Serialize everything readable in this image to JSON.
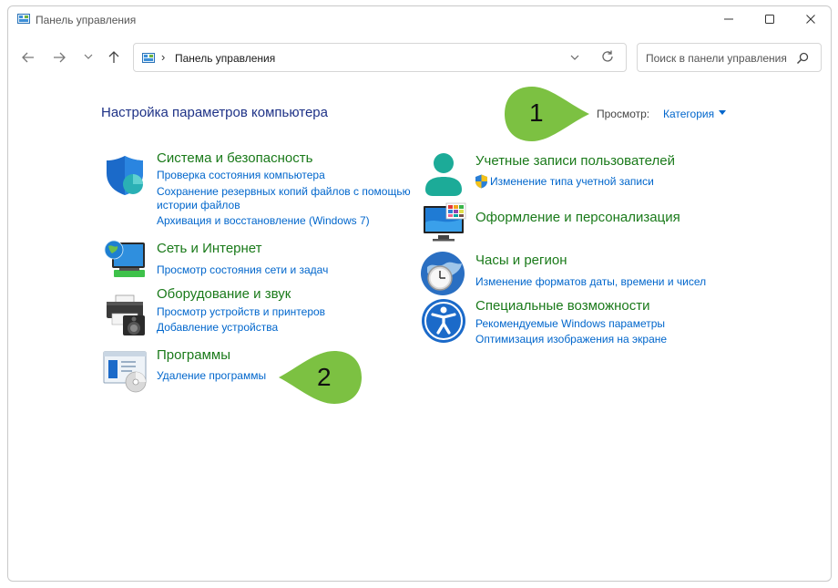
{
  "window": {
    "title": "Панель управления"
  },
  "nav": {
    "back_icon": "arrow-left-icon",
    "forward_icon": "arrow-right-icon",
    "recent_icon": "chevron-down-icon",
    "up_icon": "arrow-up-icon"
  },
  "address": {
    "path": "Панель управления"
  },
  "search": {
    "placeholder": "Поиск в панели управления"
  },
  "main": {
    "heading": "Настройка параметров компьютера",
    "view_label": "Просмотр:",
    "view_value": "Категория"
  },
  "categories": [
    {
      "title": "Система и безопасность",
      "icon": "shield-icon",
      "links": [
        "Проверка состояния компьютера",
        "Сохранение резервных копий файлов с помощью",
        "истории файлов",
        "Архивация и восстановление (Windows 7)"
      ]
    },
    {
      "title": "Сеть и Интернет",
      "icon": "network-globe-icon",
      "links": [
        "Просмотр состояния сети и задач"
      ]
    },
    {
      "title": "Оборудование и звук",
      "icon": "printer-speaker-icon",
      "links": [
        "Просмотр устройств и принтеров",
        "Добавление устройства"
      ]
    },
    {
      "title": "Программы",
      "icon": "programs-disc-icon",
      "links": [
        "Удаление программы"
      ]
    },
    {
      "title": "Учетные записи пользователей",
      "icon": "user-icon",
      "links": [
        "Изменение типа учетной записи"
      ]
    },
    {
      "title": "Оформление и персонализация",
      "icon": "monitor-personalization-icon",
      "links": []
    },
    {
      "title": "Часы и регион",
      "icon": "clock-globe-icon",
      "links": [
        "Изменение форматов даты, времени и чисел"
      ]
    },
    {
      "title": "Специальные возможности",
      "icon": "accessibility-icon",
      "links": [
        "Рекомендуемые Windows параметры",
        "Оптимизация изображения на экране"
      ]
    }
  ],
  "callouts": [
    "1",
    "2"
  ],
  "colors": {
    "title_green": "#1a7a1a",
    "link_blue": "#0066cc",
    "heading_blue": "#1e3287",
    "callout_green": "#7cc142"
  }
}
